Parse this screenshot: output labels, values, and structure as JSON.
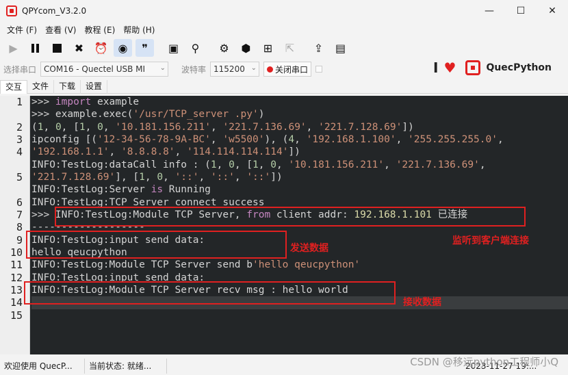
{
  "window": {
    "title": "QPYcom_V3.2.0",
    "controls": [
      "—",
      "☐",
      "✕"
    ]
  },
  "menu": [
    "文件 (F)",
    "查看 (V)",
    "教程 (E)",
    "帮助 (H)"
  ],
  "toolbar": {
    "icons": [
      "play-icon",
      "pause-icon",
      "stop-icon",
      "clear-icon",
      "alarm-icon",
      "headset-icon",
      "quote-icon",
      "save-icon",
      "search-icon",
      "settings-icon",
      "cube-icon",
      "add-icon",
      "external-icon",
      "upload-icon",
      "bag-icon"
    ]
  },
  "port": {
    "select_label": "选择串口",
    "com_value": "COM16 - Quectel USB MI",
    "baud_label": "波特率",
    "baud_value": "115200",
    "close_label": "关闭串口",
    "brand": "QuecPython"
  },
  "tabs": [
    "交互",
    "文件",
    "下载",
    "设置"
  ],
  "terminal": {
    "lines": [
      [
        {
          "t": ">>> ",
          "c": "plain"
        },
        {
          "t": "import",
          "c": "kw"
        },
        {
          "t": " example",
          "c": "plain"
        }
      ],
      [
        {
          "t": ">>> example.exec(",
          "c": "plain"
        },
        {
          "t": "'/usr/TCP_server .py'",
          "c": "str"
        },
        {
          "t": ")",
          "c": "plain"
        }
      ],
      [
        {
          "t": "(",
          "c": "plain"
        },
        {
          "t": "1",
          "c": "num"
        },
        {
          "t": ", ",
          "c": "plain"
        },
        {
          "t": "0",
          "c": "num"
        },
        {
          "t": ", [",
          "c": "plain"
        },
        {
          "t": "1",
          "c": "num"
        },
        {
          "t": ", ",
          "c": "plain"
        },
        {
          "t": "0",
          "c": "num"
        },
        {
          "t": ", ",
          "c": "plain"
        },
        {
          "t": "'10.181.156.211'",
          "c": "str"
        },
        {
          "t": ", ",
          "c": "plain"
        },
        {
          "t": "'221.7.136.69'",
          "c": "str"
        },
        {
          "t": ", ",
          "c": "plain"
        },
        {
          "t": "'221.7.128.69'",
          "c": "str"
        },
        {
          "t": "])",
          "c": "plain"
        }
      ],
      [
        {
          "t": "ipconfig [(",
          "c": "plain"
        },
        {
          "t": "'12-34-56-78-9A-BC'",
          "c": "str"
        },
        {
          "t": ", ",
          "c": "plain"
        },
        {
          "t": "'w5500'",
          "c": "str"
        },
        {
          "t": "), (",
          "c": "plain"
        },
        {
          "t": "4",
          "c": "num"
        },
        {
          "t": ", ",
          "c": "plain"
        },
        {
          "t": "'192.168.1.100'",
          "c": "str"
        },
        {
          "t": ", ",
          "c": "plain"
        },
        {
          "t": "'255.255.255.0'",
          "c": "str"
        },
        {
          "t": ",",
          "c": "plain"
        }
      ],
      [
        {
          "t": "'192.168.1.1'",
          "c": "str"
        },
        {
          "t": ", ",
          "c": "plain"
        },
        {
          "t": "'8.8.8.8'",
          "c": "str"
        },
        {
          "t": ", ",
          "c": "plain"
        },
        {
          "t": "'114.114.114.114'",
          "c": "str"
        },
        {
          "t": "])",
          "c": "plain"
        }
      ],
      [
        {
          "t": "INFO:TestLog:dataCall info : (",
          "c": "plain"
        },
        {
          "t": "1",
          "c": "num"
        },
        {
          "t": ", ",
          "c": "plain"
        },
        {
          "t": "0",
          "c": "num"
        },
        {
          "t": ", [",
          "c": "plain"
        },
        {
          "t": "1",
          "c": "num"
        },
        {
          "t": ", ",
          "c": "plain"
        },
        {
          "t": "0",
          "c": "num"
        },
        {
          "t": ", ",
          "c": "plain"
        },
        {
          "t": "'10.181.156.211'",
          "c": "str"
        },
        {
          "t": ", ",
          "c": "plain"
        },
        {
          "t": "'221.7.136.69'",
          "c": "str"
        },
        {
          "t": ",",
          "c": "plain"
        }
      ],
      [
        {
          "t": "'221.7.128.69'",
          "c": "str"
        },
        {
          "t": "], [",
          "c": "plain"
        },
        {
          "t": "1",
          "c": "num"
        },
        {
          "t": ", ",
          "c": "plain"
        },
        {
          "t": "0",
          "c": "num"
        },
        {
          "t": ", ",
          "c": "plain"
        },
        {
          "t": "'::'",
          "c": "str"
        },
        {
          "t": ", ",
          "c": "plain"
        },
        {
          "t": "'::'",
          "c": "str"
        },
        {
          "t": ", ",
          "c": "plain"
        },
        {
          "t": "'::'",
          "c": "str"
        },
        {
          "t": "])",
          "c": "plain"
        }
      ],
      [
        {
          "t": "INFO:TestLog:Server ",
          "c": "plain"
        },
        {
          "t": "is",
          "c": "kw"
        },
        {
          "t": " Running",
          "c": "plain"
        }
      ],
      [
        {
          "t": "INFO:TestLog:TCP Server connect success",
          "c": "plain"
        }
      ],
      [
        {
          "t": ">>> INFO:TestLog:Module TCP Server, ",
          "c": "plain"
        },
        {
          "t": "from",
          "c": "kw"
        },
        {
          "t": " client addr: ",
          "c": "plain"
        },
        {
          "t": "192.168.1.101",
          "c": "ip"
        },
        {
          "t": " 已连接",
          "c": "plain"
        }
      ],
      [
        {
          "t": "-------------------",
          "c": "plain"
        }
      ],
      [
        {
          "t": "INFO:TestLog:input send data:",
          "c": "plain"
        }
      ],
      [
        {
          "t": "hello qeucpython",
          "c": "plain"
        }
      ],
      [
        {
          "t": "INFO:TestLog:Module TCP Server send b",
          "c": "plain"
        },
        {
          "t": "'hello qeucpython'",
          "c": "str"
        }
      ],
      [
        {
          "t": "INFO:TestLog:input send data:",
          "c": "plain"
        }
      ],
      [
        {
          "t": "INFO:TestLog:Module TCP Server recv msg : hello world",
          "c": "plain"
        }
      ],
      []
    ],
    "line_numbers": [
      "1",
      "",
      "2",
      "3",
      "4",
      "",
      "5",
      "",
      "6",
      "7",
      "8",
      "9",
      "10",
      "11",
      "12",
      "13",
      "14",
      "15"
    ]
  },
  "annotations": {
    "send_label": "发送数据",
    "listen_label": "监听到客户端连接",
    "recv_label": "接收数据"
  },
  "status": {
    "welcome": "欢迎使用 QuecP...",
    "state": "当前状态: 就绪...",
    "time": "2023-11-27 19:...",
    "watermark": "CSDN @移远python工程师小Q"
  }
}
